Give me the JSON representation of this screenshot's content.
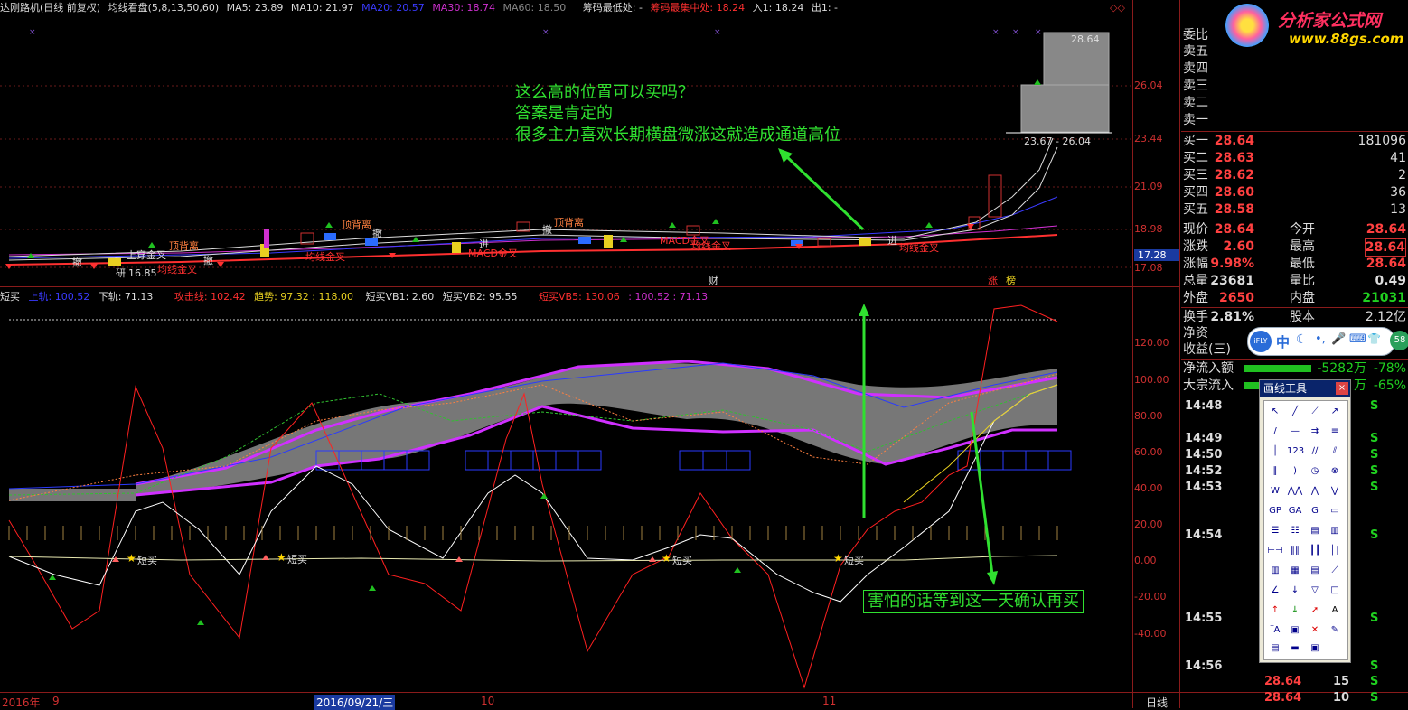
{
  "title_bar": {
    "stock": "达刚路机(日线 前复权)",
    "indicator": "均线看盘(5,8,13,50,60)",
    "ma5": "MA5: 23.89",
    "ma10": "MA10: 21.97",
    "ma20": "MA20: 20.57",
    "ma30": "MA30: 18.74",
    "ma60": "MA60: 18.50",
    "chip_low": "筹码最低处: -",
    "chip_focus": "筹码最集中处: 18.24",
    "entry": "入1: 18.24",
    "exit": "出1: -",
    "corner_icon": "◇◇"
  },
  "price_axis": [
    "26.04",
    "23.44",
    "21.09",
    "18.98",
    "17.28",
    "17.08"
  ],
  "price_labels": {
    "box_top": "28.64",
    "box_range": "23.67 - 26.04",
    "low_mark": "16.85",
    "current_tag": "17.28"
  },
  "candle_annotations": [
    "顶背离",
    "顶背离",
    "顶背离",
    "撤",
    "撤",
    "撤",
    "进",
    "进",
    "进",
    "MACD金叉",
    "MACD金叉",
    "MACD金叉",
    "均线金叉",
    "均线金叉",
    "均线金叉",
    "上穿金叉",
    "研",
    "财",
    "涨",
    "榜"
  ],
  "indicator_bar": {
    "name": "短买",
    "upper": "上轨: 100.52",
    "lower": "下轨: 71.13",
    "attack": "攻击线: 102.42",
    "trend": "趋势: 97.32 : 118.00",
    "vb1": "短买VB1: 2.60",
    "vb2": "短买VB2: 95.55",
    "vb5": "短买VB5: 130.06",
    "extra": ": 100.52 : 71.13"
  },
  "ind_axis": [
    "120.00",
    "100.00",
    "80.00",
    "60.00",
    "40.00",
    "20.00",
    "0.00",
    "-20.00",
    "-40.00"
  ],
  "short_buy_labels": [
    "短买",
    "短买",
    "短买",
    "短买",
    "短买"
  ],
  "annotations": {
    "q1": "这么高的位置可以买吗？",
    "q2": "答案是肯定的",
    "q3": "很多主力喜欢长期横盘微涨这就造成通道高位",
    "q4": "害怕的话等到这一天确认再买"
  },
  "bottom_axis": {
    "year": "2016年",
    "m9": "9",
    "date": "2016/09/21/三",
    "m10": "10",
    "m11": "11",
    "period": "日线"
  },
  "logo": {
    "main": "分析家公式网",
    "url": "www.88gs.com"
  },
  "order_book": {
    "weibi": "委比",
    "sells": [
      "卖五",
      "卖四",
      "卖三",
      "卖二",
      "卖一"
    ],
    "buys": [
      {
        "label": "买一",
        "price": "28.64",
        "vol": "181096"
      },
      {
        "label": "买二",
        "price": "28.63",
        "vol": "41"
      },
      {
        "label": "买三",
        "price": "28.62",
        "vol": "2"
      },
      {
        "label": "买四",
        "price": "28.60",
        "vol": "36"
      },
      {
        "label": "买五",
        "price": "28.58",
        "vol": "13"
      }
    ]
  },
  "quote": [
    {
      "k": "现价",
      "v": "28.64",
      "k2": "今开",
      "v2": "28.64"
    },
    {
      "k": "涨跌",
      "v": "2.60",
      "k2": "最高",
      "v2": "28.64"
    },
    {
      "k": "涨幅",
      "v": "9.98%",
      "k2": "最低",
      "v2": "28.64"
    },
    {
      "k": "总量",
      "v": "23681",
      "k2": "量比",
      "v2": "0.49"
    },
    {
      "k": "外盘",
      "v": "2650",
      "k2": "内盘",
      "v2": "21031"
    },
    {
      "k": "换手",
      "v": "2.81%",
      "k2": "股本",
      "v2": "2.12亿"
    },
    {
      "k": "净资",
      "v": "",
      "k2": "",
      "v2": ""
    },
    {
      "k": "收益(三)",
      "v": "",
      "k2": "",
      "v2": ""
    }
  ],
  "flow": [
    {
      "k": "净流入额",
      "v": "-5282万",
      "p": "-78%"
    },
    {
      "k": "大宗流入",
      "v": "万",
      "p": "-65%"
    }
  ],
  "ime_bar": [
    "iFLY",
    "中",
    "☾",
    "•,",
    "🎤",
    "⌨",
    "👕"
  ],
  "ime_badge": "58",
  "trades": [
    {
      "t": "14:48",
      "s": "S"
    },
    {
      "t": "14:49",
      "s": "S"
    },
    {
      "t": "14:50",
      "s": "S"
    },
    {
      "t": "14:52",
      "s": "S"
    },
    {
      "t": "14:53",
      "s": "S"
    },
    {
      "t": "14:54",
      "s": "S"
    },
    {
      "t": "14:55",
      "s": "S"
    },
    {
      "t": "14:56",
      "s": "S"
    }
  ],
  "trades_tail": [
    {
      "p": "28.64",
      "v": "15",
      "s": "S"
    },
    {
      "p": "28.64",
      "v": "10",
      "s": "S"
    }
  ],
  "toolbox": {
    "title": "画线工具",
    "close": "×"
  },
  "colors": {
    "up": "#ff3030",
    "down": "#20c020",
    "ma20": "#3a3aff",
    "ma30": "#d030d0",
    "annot": "#30e030"
  }
}
